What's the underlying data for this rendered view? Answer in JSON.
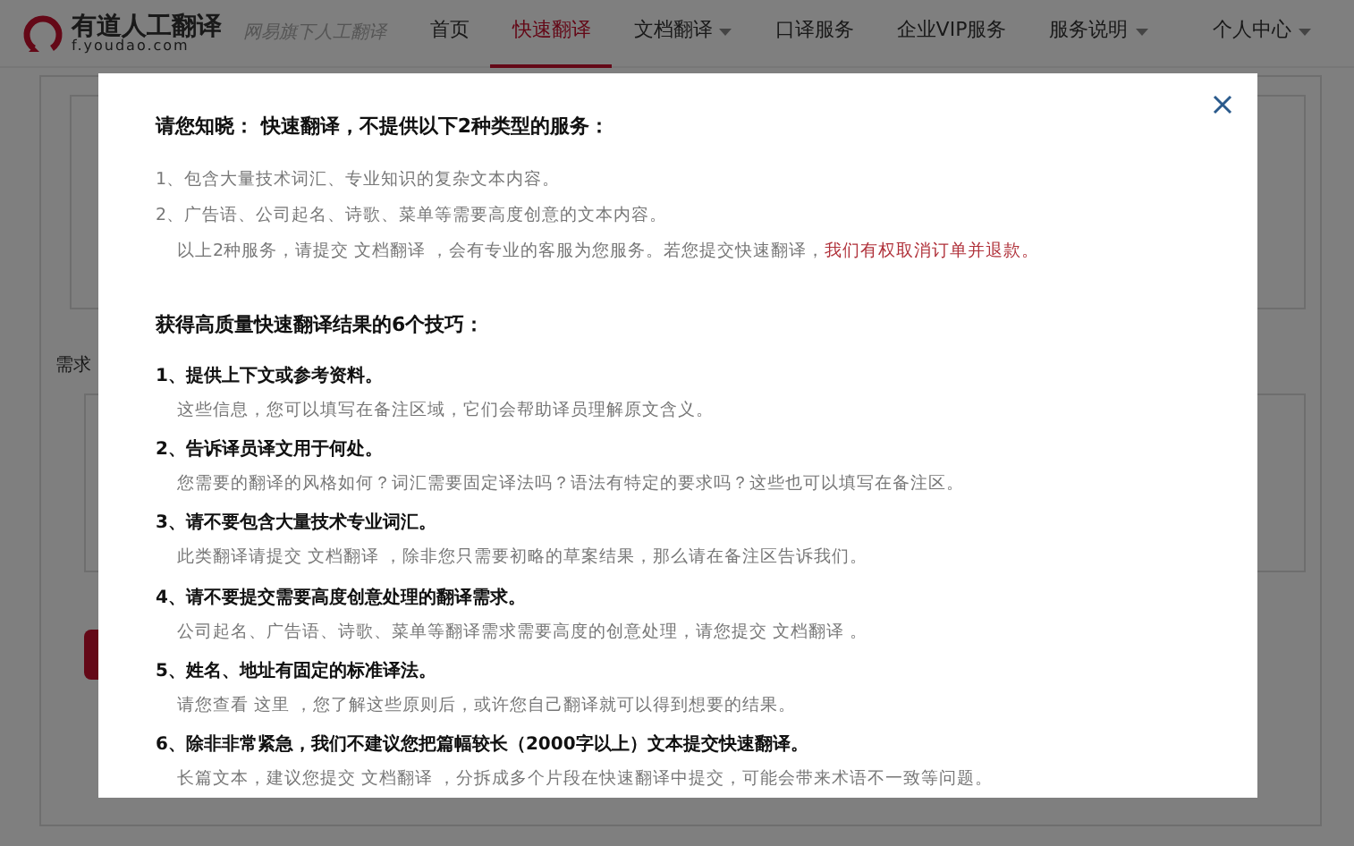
{
  "navbar": {
    "logo_title": "有道人工翻译",
    "logo_url": "f.youdao.com",
    "slogan": "网易旗下人工翻译",
    "items": [
      {
        "label": "首页",
        "selected": false,
        "dropdown": false
      },
      {
        "label": "快速翻译",
        "selected": true,
        "dropdown": false
      },
      {
        "label": "文档翻译",
        "selected": false,
        "dropdown": true
      },
      {
        "label": "口译服务",
        "selected": false,
        "dropdown": false
      },
      {
        "label": "企业VIP服务",
        "selected": false,
        "dropdown": false
      },
      {
        "label": "服务说明",
        "selected": false,
        "dropdown": true
      }
    ],
    "user_menu": "个人中心"
  },
  "background": {
    "section_label": "需求"
  },
  "modal": {
    "title": "请您知晓： 快速翻译，不提供以下2种类型的服务：",
    "restrictions": [
      "1、包含大量技术词汇、专业知识的复杂文本内容。",
      "2、广告语、公司起名、诗歌、菜单等需要高度创意的文本内容。"
    ],
    "note": "以上2种服务，请提交 文档翻译 ，会有专业的客服为您服务。若您提交快速翻译，",
    "warning": "我们有权取消订单并退款。",
    "tips_title": "获得高质量快速翻译结果的6个技巧：",
    "tips": [
      {
        "title": "1、提供上下文或参考资料。",
        "text": "这些信息，您可以填写在备注区域，它们会帮助译员理解原文含义。"
      },
      {
        "title": "2、告诉译员译文用于何处。",
        "text": "您需要的翻译的风格如何？词汇需要固定译法吗？语法有特定的要求吗？这些也可以填写在备注区。"
      },
      {
        "title": "3、请不要包含大量技术专业词汇。",
        "text": "此类翻译请提交 文档翻译 ，除非您只需要初略的草案结果，那么请在备注区告诉我们。"
      },
      {
        "title": "4、请不要提交需要高度创意处理的翻译需求。",
        "text": "公司起名、广告语、诗歌、菜单等翻译需求需要高度的创意处理，请您提交 文档翻译 。"
      },
      {
        "title": "5、姓名、地址有固定的标准译法。",
        "text": "请您查看 这里 ，您了解这些原则后，或许您自己翻译就可以得到想要的结果。"
      },
      {
        "title": "6、除非非常紧急，我们不建议您把篇幅较长（2000字以上）文本提交快速翻译。",
        "text": "长篇文本，建议您提交 文档翻译 ，分拆成多个片段在快速翻译中提交，可能会带来术语不一致等问题。"
      }
    ]
  }
}
